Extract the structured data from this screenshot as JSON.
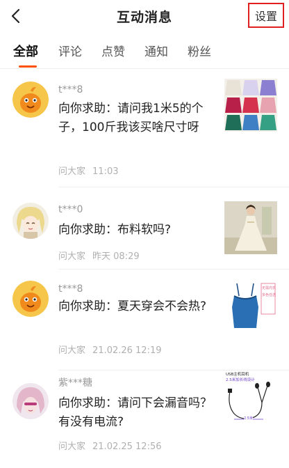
{
  "header": {
    "title": "互动消息",
    "settings_label": "设置"
  },
  "tabs": [
    {
      "label": "全部",
      "active": true
    },
    {
      "label": "评论",
      "active": false
    },
    {
      "label": "点赞",
      "active": false
    },
    {
      "label": "通知",
      "active": false
    },
    {
      "label": "粉丝",
      "active": false
    }
  ],
  "colors": {
    "accent": "#ff5000",
    "highlight_border": "#e02020"
  },
  "messages": [
    {
      "username": "t***8",
      "question": "向你求助：请问我1米5的个子，100斤我该买啥尺寸呀",
      "source": "问大家",
      "time": "11:03",
      "avatar": "orange-mascot-avatar",
      "thumbnail": "pleated-skirts-grid"
    },
    {
      "username": "t***0",
      "question": "向你求助：布料软吗?",
      "source": "问大家",
      "time": "昨天 08:29",
      "avatar": "anime-girl-avatar",
      "thumbnail": "white-dress-model"
    },
    {
      "username": "t***8",
      "question": "向你求助：夏天穿会不会热?",
      "source": "问大家",
      "time": "21.02.26 12:19",
      "avatar": "orange-mascot-avatar",
      "thumbnail": "blue-camisole",
      "thumbnail_tag_lines": [
        "无需内衣",
        "多色任选"
      ]
    },
    {
      "username": "紫***糖",
      "question": "向你求助：请问下会漏音吗？有没有电流?",
      "source": "问大家",
      "time": "21.02.25 12:56",
      "avatar": "pink-hair-avatar",
      "thumbnail": "usb-earphones",
      "thumbnail_text": {
        "line1": "USB主机耳机",
        "line2": "2.5米加长线设计",
        "measure": "2.5米"
      }
    }
  ]
}
